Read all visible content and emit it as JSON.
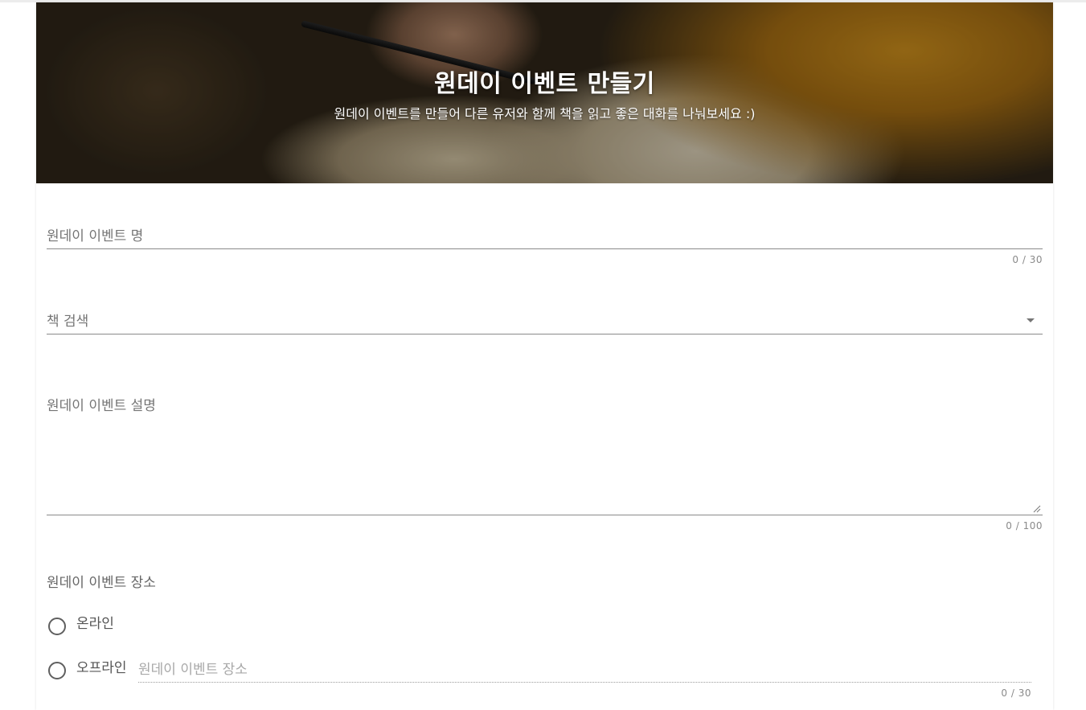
{
  "hero": {
    "title": "원데이 이벤트 만들기",
    "subtitle": "원데이 이벤트를 만들어 다른 유저와 함께 책을 읽고 좋은 대화를 나눠보세요 :)"
  },
  "form": {
    "event_name": {
      "label": "원데이 이벤트 명",
      "value": "",
      "counter": "0 / 30"
    },
    "book_search": {
      "label": "책 검색",
      "selected": ""
    },
    "description": {
      "label": "원데이 이벤트 설명",
      "value": "",
      "counter": "0 / 100"
    },
    "location": {
      "label": "원데이 이벤트 장소",
      "options": [
        {
          "label": "온라인",
          "selected": false
        },
        {
          "label": "오프라인",
          "selected": false
        }
      ],
      "offline_placeholder": "원데이 이벤트 장소",
      "counter": "0 / 30"
    }
  },
  "colors": {
    "text_primary": "#333333",
    "label_gray": "#757575",
    "counter_gray": "#8a8a8a",
    "line": "#8a8a8a",
    "hero_text": "#ffffff"
  }
}
